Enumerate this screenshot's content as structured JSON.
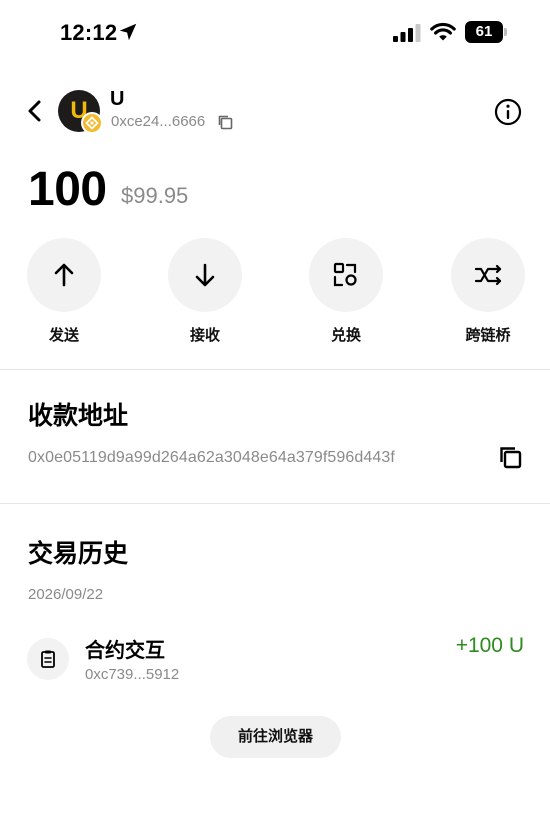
{
  "status_bar": {
    "time": "12:12",
    "battery": "61",
    "icons": [
      "location-arrow-icon",
      "signal-icon",
      "wifi-icon",
      "battery-icon"
    ]
  },
  "header": {
    "token_symbol": "U",
    "avatar_letter": "U",
    "contract_short": "0xce24...6666"
  },
  "balance": {
    "amount": "100",
    "usd": "$99.95"
  },
  "actions": [
    {
      "label": "发送",
      "icon": "arrow-up-icon"
    },
    {
      "label": "接收",
      "icon": "arrow-down-icon"
    },
    {
      "label": "兑换",
      "icon": "swap-icon"
    },
    {
      "label": "跨链桥",
      "icon": "bridge-icon"
    }
  ],
  "receive": {
    "title": "收款地址",
    "address": "0x0e05119d9a99d264a62a3048e64a379f596d443f"
  },
  "history": {
    "title": "交易历史",
    "date": "2026/09/22",
    "transactions": [
      {
        "title": "合约交互",
        "hash": "0xc739...5912",
        "amount": "+100 U"
      }
    ],
    "browser_button": "前往浏览器"
  },
  "colors": {
    "positive": "#2e8b1e",
    "muted": "#8a8a8a",
    "button_bg": "#f2f2f2",
    "badge": "#f3ba2f"
  }
}
